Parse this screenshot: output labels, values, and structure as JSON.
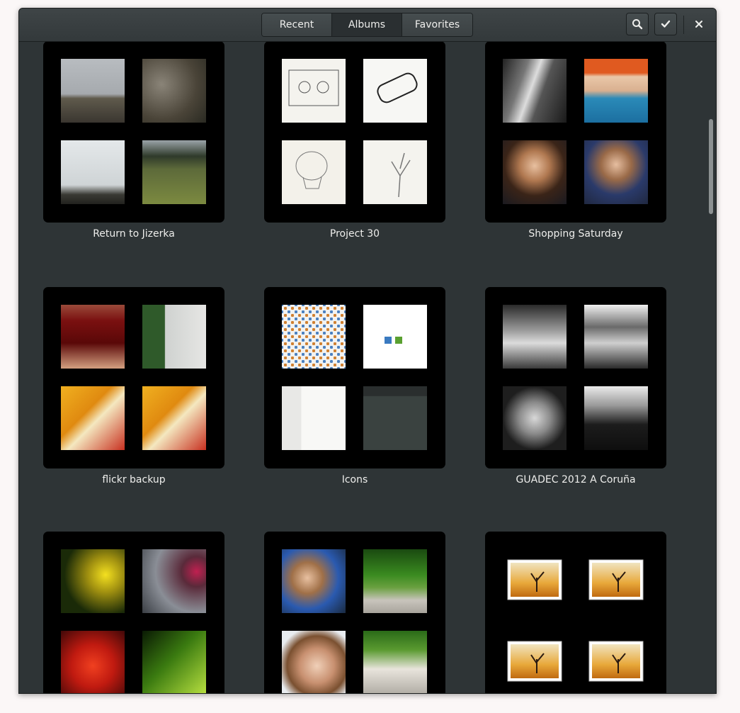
{
  "header": {
    "tabs": [
      {
        "label": "Recent",
        "active": false
      },
      {
        "label": "Albums",
        "active": true
      },
      {
        "label": "Favorites",
        "active": false
      }
    ],
    "buttons": {
      "search_icon": "search-icon",
      "select_icon": "checkmark-icon",
      "close_icon": "close-icon"
    }
  },
  "albums": [
    {
      "title": "Return to Jizerka"
    },
    {
      "title": "Project 30"
    },
    {
      "title": "Shopping Saturday"
    },
    {
      "title": "flickr backup"
    },
    {
      "title": "Icons"
    },
    {
      "title": "GUADEC 2012 A Coruña"
    },
    {
      "title": ""
    },
    {
      "title": ""
    },
    {
      "title": ""
    }
  ],
  "colors": {
    "window_bg": "#2e3436",
    "cover_bg": "#000000",
    "text": "#eeeeec"
  }
}
